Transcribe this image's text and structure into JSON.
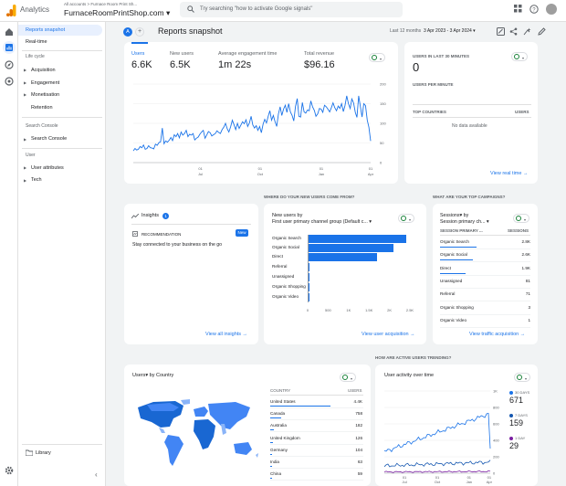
{
  "topbar": {
    "app": "Analytics",
    "crumb": "All accounts > Furnace Room Print Sh...",
    "property": "FurnaceRoomPrintShop.com ▾",
    "search_placeholder": "Try searching \"how to activate Google signals\""
  },
  "nav": {
    "reports_snapshot": "Reports snapshot",
    "realtime": "Real-time",
    "life_cycle": "Life cycle",
    "acquisition": "Acquisition",
    "engagement": "Engagement",
    "monetisation": "Monetisation",
    "retention": "Retention",
    "search_console_h": "Search Console",
    "search_console": "Search Console",
    "user_h": "User",
    "user_attributes": "User attributes",
    "tech": "Tech",
    "library": "Library"
  },
  "header": {
    "avatar_letter": "A",
    "title": "Reports snapshot",
    "range_label": "Last 12 months",
    "range": "3 Apr 2023 - 3 Apr 2024 ▾"
  },
  "metrics": [
    {
      "label": "Users",
      "value": "6.6K"
    },
    {
      "label": "New users",
      "value": "6.5K"
    },
    {
      "label": "Average engagement time",
      "value": "1m 22s"
    },
    {
      "label": "Total revenue",
      "value": "$96.16"
    }
  ],
  "main_chart": {
    "x_ticks": [
      {
        "d": "01",
        "m": "Jul"
      },
      {
        "d": "01",
        "m": "Oct"
      },
      {
        "d": "01",
        "m": "Jan"
      },
      {
        "d": "01",
        "m": "Apr"
      }
    ],
    "y_ticks": [
      "200",
      "150",
      "100",
      "50",
      "0"
    ],
    "series": [
      30,
      36,
      32,
      34,
      41,
      38,
      45,
      34,
      36,
      43,
      38,
      37,
      35,
      47,
      44,
      51,
      53,
      88,
      48,
      55,
      52,
      57,
      64,
      56,
      71,
      66,
      74,
      63,
      78,
      70,
      74,
      82,
      66,
      72,
      70,
      74,
      58,
      62,
      65,
      72,
      78,
      82,
      62,
      70,
      79,
      76,
      68,
      71,
      74,
      81,
      77,
      74,
      84,
      90,
      100,
      86,
      78,
      91,
      108,
      96,
      84,
      100,
      87,
      95,
      104,
      99,
      109,
      92,
      101,
      118,
      96,
      88,
      94,
      82,
      92,
      76,
      98,
      110,
      101,
      118,
      132,
      108,
      120,
      104,
      92,
      124,
      142,
      120,
      136,
      146,
      128,
      150,
      129,
      120,
      106,
      143,
      163,
      118,
      116,
      153,
      129,
      126,
      134,
      132,
      157,
      142,
      133,
      118,
      124,
      138,
      136,
      128,
      146,
      142,
      136,
      129,
      140,
      152,
      140,
      132,
      144,
      138,
      150,
      130,
      145,
      170,
      150,
      138,
      162,
      152,
      128,
      115,
      170,
      142,
      116,
      150,
      145,
      108,
      90,
      55
    ]
  },
  "realtime": {
    "title": "USERS IN LAST 30 MINUTES",
    "value": "0",
    "sub": "USERS PER MINUTE",
    "col1": "TOP COUNTRIES",
    "col2": "USERS",
    "empty": "No data available",
    "link": "View real time →"
  },
  "section_labels": {
    "where": "WHERE DO YOUR NEW USERS COME FROM?",
    "campaigns": "WHAT ARE YOUR TOP CAMPAIGNS?",
    "trending": "HOW ARE ACTIVE USERS TRENDING?"
  },
  "insights": {
    "title": "Insights",
    "badge": "1",
    "rec": "RECOMMENDATION",
    "new": "New",
    "text": "Stay connected to your business on the go",
    "link": "View all insights →"
  },
  "acq": {
    "title1": "New users by",
    "title2": "First user primary channel group (Default c... ▾",
    "rows": [
      {
        "label": "Organic Search",
        "value": 2400
      },
      {
        "label": "Organic Social",
        "value": 2100
      },
      {
        "label": "Direct",
        "value": 1700
      },
      {
        "label": "Referral",
        "value": 50
      },
      {
        "label": "Unassigned",
        "value": 20
      },
      {
        "label": "Organic Shopping",
        "value": 10
      },
      {
        "label": "Organic Video",
        "value": 5
      }
    ],
    "x_ticks": [
      "0",
      "500",
      "1K",
      "1.5K",
      "2K",
      "2.5K"
    ],
    "link": "View user acquisition →"
  },
  "campaigns": {
    "title1": "Sessions▾ by",
    "title2": "Session primary ch... ▾",
    "col1": "SESSION PRIMARY ...",
    "col2": "SESSIONS",
    "rows": [
      {
        "label": "Organic Search",
        "value": "2.8K"
      },
      {
        "label": "Organic Social",
        "value": "2.6K"
      },
      {
        "label": "Direct",
        "value": "1.9K"
      },
      {
        "label": "Unassigned",
        "value": "81"
      },
      {
        "label": "Referral",
        "value": "71"
      },
      {
        "label": "Organic Shopping",
        "value": "3"
      },
      {
        "label": "Organic Video",
        "value": "1"
      }
    ],
    "link": "View traffic acquisition →"
  },
  "country": {
    "title": "Users▾ by Country",
    "col1": "COUNTRY",
    "col2": "USERS",
    "rows": [
      {
        "label": "United States",
        "value": "4.4K"
      },
      {
        "label": "Canada",
        "value": "758"
      },
      {
        "label": "Australia",
        "value": "182"
      },
      {
        "label": "United Kingdom",
        "value": "126"
      },
      {
        "label": "Germany",
        "value": "104"
      },
      {
        "label": "India",
        "value": "63"
      },
      {
        "label": "China",
        "value": "59"
      }
    ]
  },
  "activity": {
    "title": "User activity over time",
    "y_ticks": [
      "1K",
      "800",
      "600",
      "400",
      "200",
      "0"
    ],
    "x_ticks": [
      {
        "d": "01",
        "m": "Jul"
      },
      {
        "d": "01",
        "m": "Oct"
      },
      {
        "d": "01",
        "m": "Jan"
      },
      {
        "d": "01",
        "m": "Apr"
      }
    ],
    "legend": [
      {
        "label": "30 DAYS",
        "value": "671",
        "color": "#1a73e8"
      },
      {
        "label": "7 DAYS",
        "value": "159",
        "color": "#1557b0"
      },
      {
        "label": "1 DAY",
        "value": "29",
        "color": "#7b1fa2"
      }
    ]
  }
}
